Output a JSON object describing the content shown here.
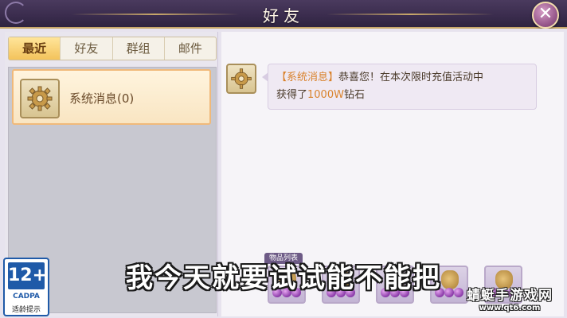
{
  "header": {
    "title": "好友",
    "close_icon": "close-icon"
  },
  "tabs": [
    {
      "label": "最近",
      "active": true
    },
    {
      "label": "好友",
      "active": false
    },
    {
      "label": "群组",
      "active": false
    },
    {
      "label": "邮件",
      "active": false
    }
  ],
  "conversations": [
    {
      "label": "系统消息(0)",
      "icon": "gear-icon"
    }
  ],
  "message": {
    "icon": "gear-icon",
    "tag": "【系统消息】",
    "text_part1": "恭喜您！在本次限时充值活动中",
    "text_part2": "获得了",
    "highlight": "1000W",
    "text_part3": "钻石"
  },
  "items": {
    "tab_label": "物品列表",
    "count": 5
  },
  "subtitle": "我今天就要试试能不能把",
  "age_rating": {
    "number": "12+",
    "org": "CADPA",
    "note": "适龄提示"
  },
  "watermark": {
    "name": "蜻蜓手游戏网",
    "url": "www.qt6.com"
  },
  "colors": {
    "accent_orange": "#d9822b",
    "tab_active": "#f3c35b",
    "rating_blue": "#1f5aa8"
  }
}
